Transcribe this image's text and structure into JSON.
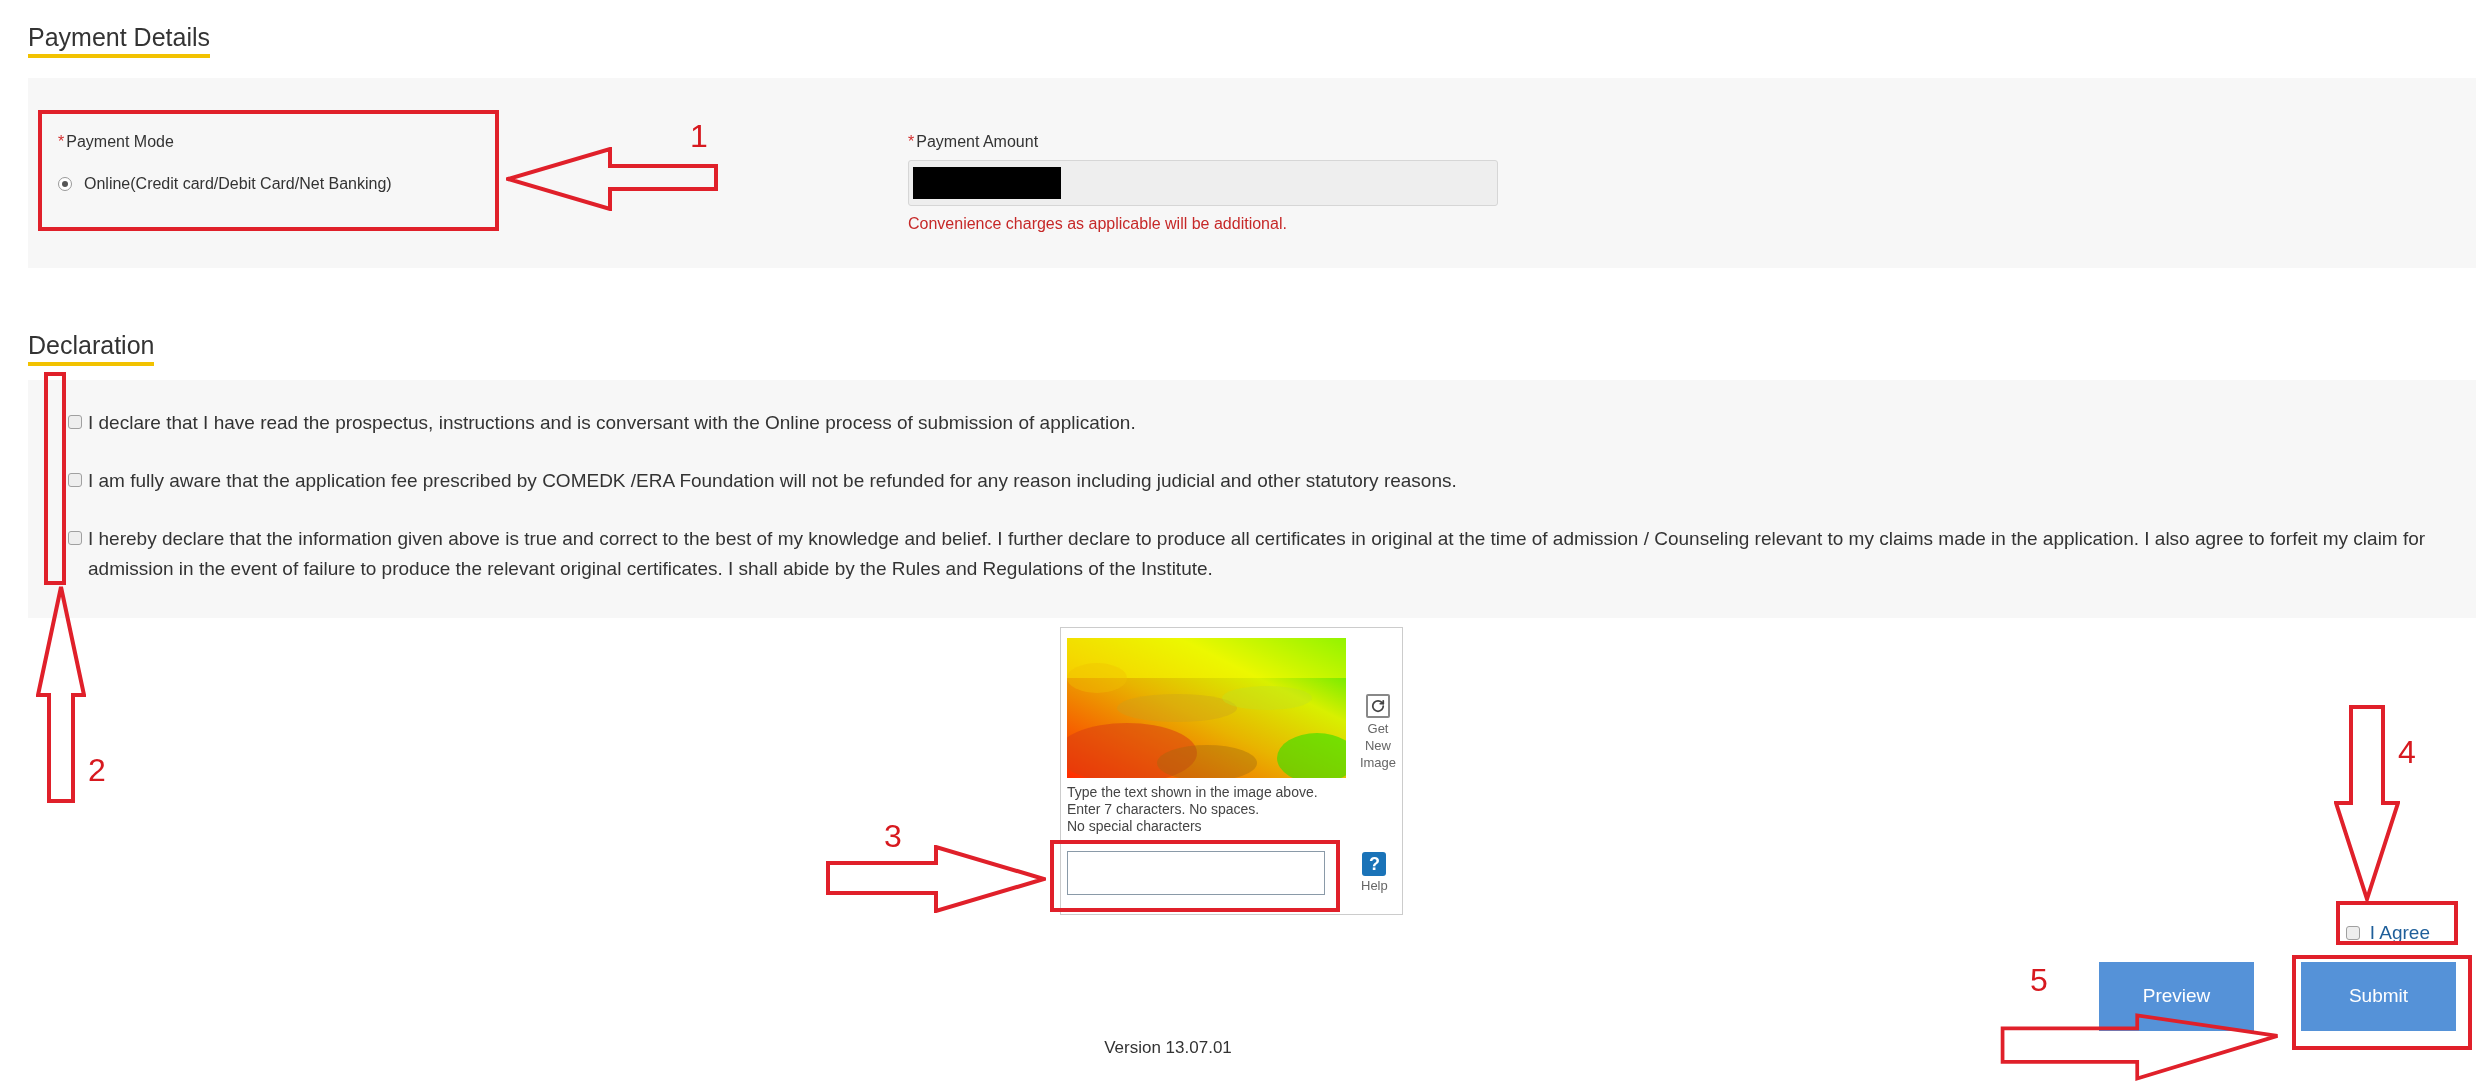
{
  "payment_details": {
    "heading": "Payment Details",
    "payment_mode": {
      "required_mark": "*",
      "label": "Payment Mode",
      "options": [
        {
          "label": "Online(Credit card/Debit Card/Net Banking)",
          "selected": true
        }
      ]
    },
    "payment_amount": {
      "required_mark": "*",
      "label": "Payment Amount",
      "redacted": true,
      "note": "Convenience charges as applicable will be additional."
    }
  },
  "declaration": {
    "heading": "Declaration",
    "items": [
      {
        "text": "I declare that I have read the prospectus, instructions and is conversant with the Online process of submission of application.",
        "checked": false
      },
      {
        "text": "I am fully aware that the application fee prescribed by COMEDK /ERA Foundation will not be refunded for any reason including judicial and other statutory reasons.",
        "checked": false
      },
      {
        "text": "I hereby declare that the information given above is true and correct to the best of my knowledge and belief. I further declare to produce all certificates in original at the time of admission / Counseling relevant to my claims made in the application. I also agree to forfeit my claim for admission in the event of failure to produce the relevant original certificates. I shall abide by the Rules and Regulations of the Institute.",
        "checked": false
      }
    ]
  },
  "captcha": {
    "refresh_label": "Get New Image",
    "instructions": [
      "Type the text shown in the image above.",
      "Enter 7 characters. No spaces.",
      "No special characters"
    ],
    "help_glyph": "?",
    "help_label": "Help"
  },
  "agree": {
    "label": "I Agree",
    "checked": false
  },
  "buttons": [
    {
      "label": "Preview"
    },
    {
      "label": "Submit"
    }
  ],
  "version": "Version 13.07.01",
  "annotations": [
    {
      "number": "1"
    },
    {
      "number": "2"
    },
    {
      "number": "3"
    },
    {
      "number": "4"
    },
    {
      "number": "5"
    }
  ]
}
